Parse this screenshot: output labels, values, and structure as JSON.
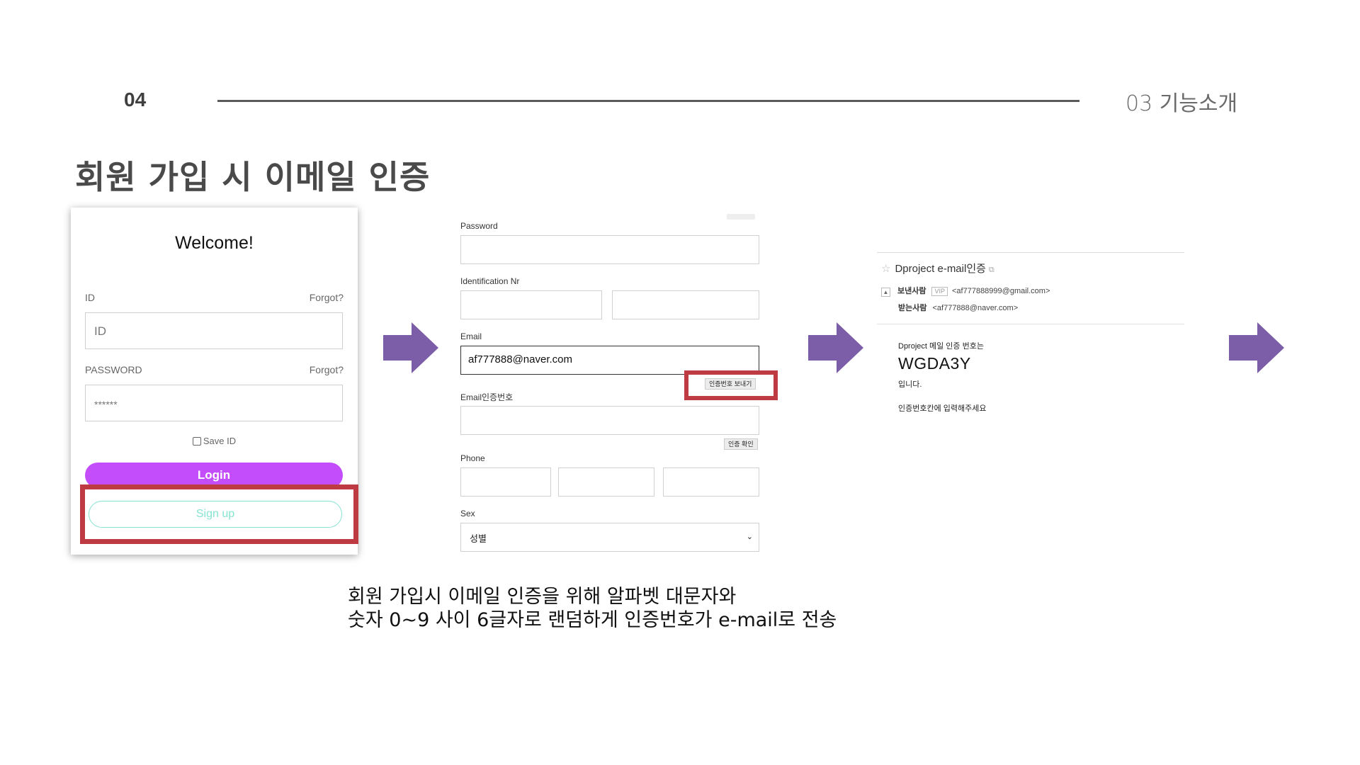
{
  "header": {
    "page_number": "04",
    "section_label": "03  기능소개",
    "title": "회원 가입 시 이메일 인증"
  },
  "login_card": {
    "title": "Welcome!",
    "id_label": "ID",
    "id_forgot": "Forgot?",
    "id_placeholder": "ID",
    "password_label": "PASSWORD",
    "password_forgot": "Forgot?",
    "password_value": "******",
    "save_id_label": "Save ID",
    "save_id_checked": false,
    "login_button": "Login",
    "signup_button": "Sign up"
  },
  "signup_form": {
    "password_label": "Password",
    "identification_label": "Identification Nr",
    "email_label": "Email",
    "email_value": "af777888@naver.com",
    "send_code_button": "인증번호 보내기",
    "email_code_label": "Email인증번호",
    "confirm_code_button": "인증 확인",
    "phone_label": "Phone",
    "sex_label": "Sex",
    "sex_selected": "성별"
  },
  "email_view": {
    "subject": "Dproject e-mail인증",
    "sender_label": "보낸사람",
    "sender_badge": "VIP",
    "sender_address": "<af777888999@gmail.com>",
    "recipient_label": "받는사람",
    "recipient_address": "<af777888@naver.com>",
    "body_intro": "Dproject 메일 인증 번호는",
    "code": "WGDA3Y",
    "body_suffix": "입니다.",
    "body_instruction": "인증번호칸에 입력해주세요"
  },
  "caption": {
    "line1": "회원 가입시 이메일 인증을 위해 알파벳 대문자와",
    "line2": "숫자 0~9 사이 6글자로 랜덤하게 인증번호가 e-mail로 전송"
  },
  "colors": {
    "arrow": "#7b5ea7",
    "highlight": "#bf3b44",
    "login_button": "#c34dfa",
    "signup_outline": "#86e3d1"
  },
  "icons": [
    "arrow-right-icon",
    "star-icon",
    "external-link-icon",
    "chevron-down-icon",
    "collapse-toggle-icon"
  ]
}
